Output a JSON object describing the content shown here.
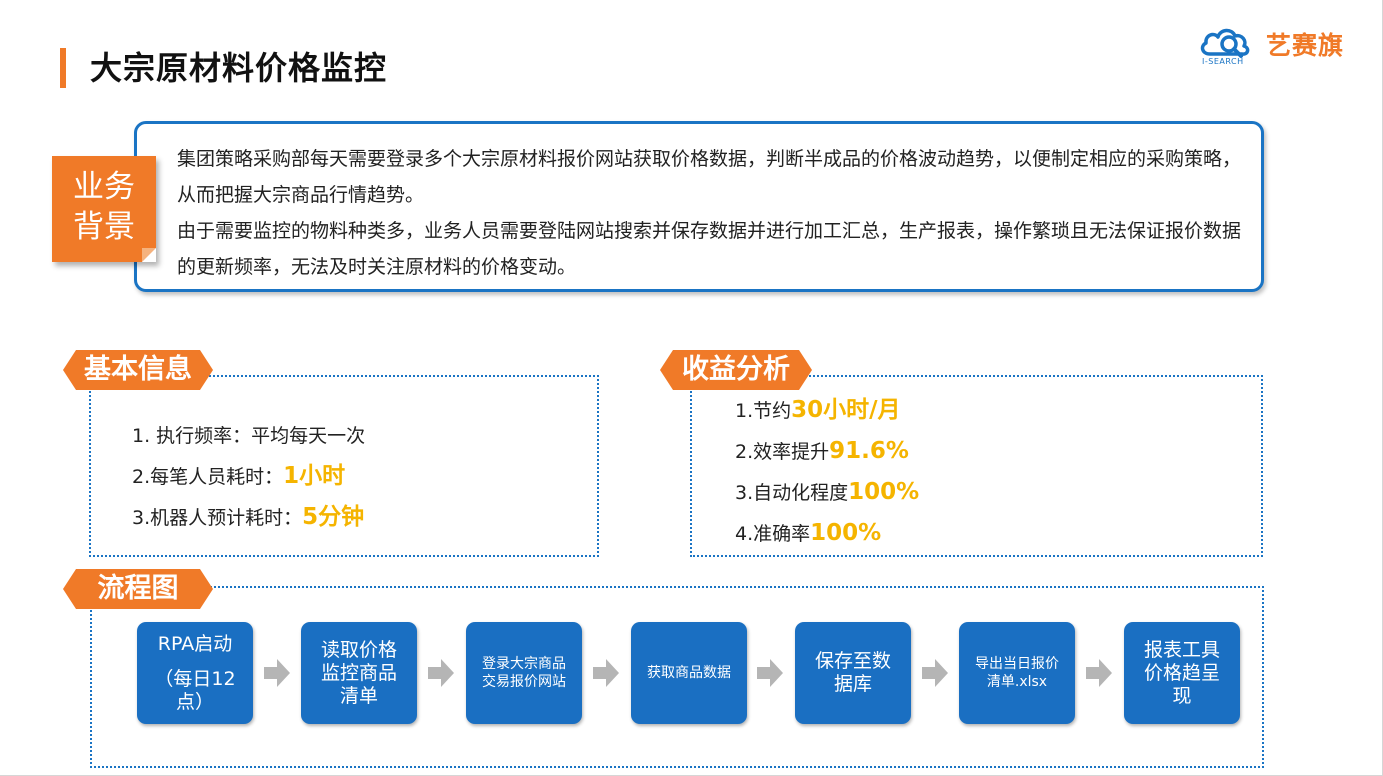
{
  "page": {
    "title": "大宗原材料价格监控"
  },
  "logo": {
    "name": "艺赛旗",
    "sub": "I-SEARCH"
  },
  "background": {
    "tag": [
      "业务",
      "背景"
    ],
    "paragraphs": [
      "集团策略采购部每天需要登录多个大宗原材料报价网站获取价格数据，判断半成品的价格波动趋势，以便制定相应的采购策略，从而把握大宗商品行情趋势。",
      "由于需要监控的物料种类多，业务人员需要登陆网站搜索并保存数据并进行加工汇总，生产报表，操作繁琐且无法保证报价数据的更新频率，无法及时关注原材料的价格变动。"
    ]
  },
  "basic_info": {
    "title": "基本信息",
    "items": [
      {
        "label": "1. 执行频率：平均每天一次",
        "value": ""
      },
      {
        "label": "2.每笔人员耗时：",
        "value": "1小时"
      },
      {
        "label": "3.机器人预计耗时：",
        "value": "5分钟"
      }
    ]
  },
  "benefit": {
    "title": "收益分析",
    "items": [
      {
        "label": "1.节约",
        "value": "30小时/月"
      },
      {
        "label": "2.效率提升",
        "value": "91.6%"
      },
      {
        "label": "3.自动化程度",
        "value": "100%"
      },
      {
        "label": "4.准确率",
        "value": "100%"
      }
    ]
  },
  "flow": {
    "title": "流程图",
    "steps": [
      {
        "lines": [
          "RPA启动",
          "",
          "（每日12",
          "点）"
        ]
      },
      {
        "lines": [
          "读取价格",
          "监控商品",
          "清单"
        ]
      },
      {
        "lines": [
          "登录大宗商品",
          "交易报价网站"
        ]
      },
      {
        "lines": [
          "获取商品数据"
        ]
      },
      {
        "lines": [
          "保存至数",
          "据库"
        ]
      },
      {
        "lines": [
          "导出当日报价",
          "清单.xlsx"
        ]
      },
      {
        "lines": [
          "报表工具",
          "价格趋呈",
          "现"
        ]
      }
    ]
  },
  "colors": {
    "accent": "#f07a28",
    "primary": "#1a74c4",
    "highlight": "#f5b400",
    "arrow": "#b5b5b5"
  }
}
